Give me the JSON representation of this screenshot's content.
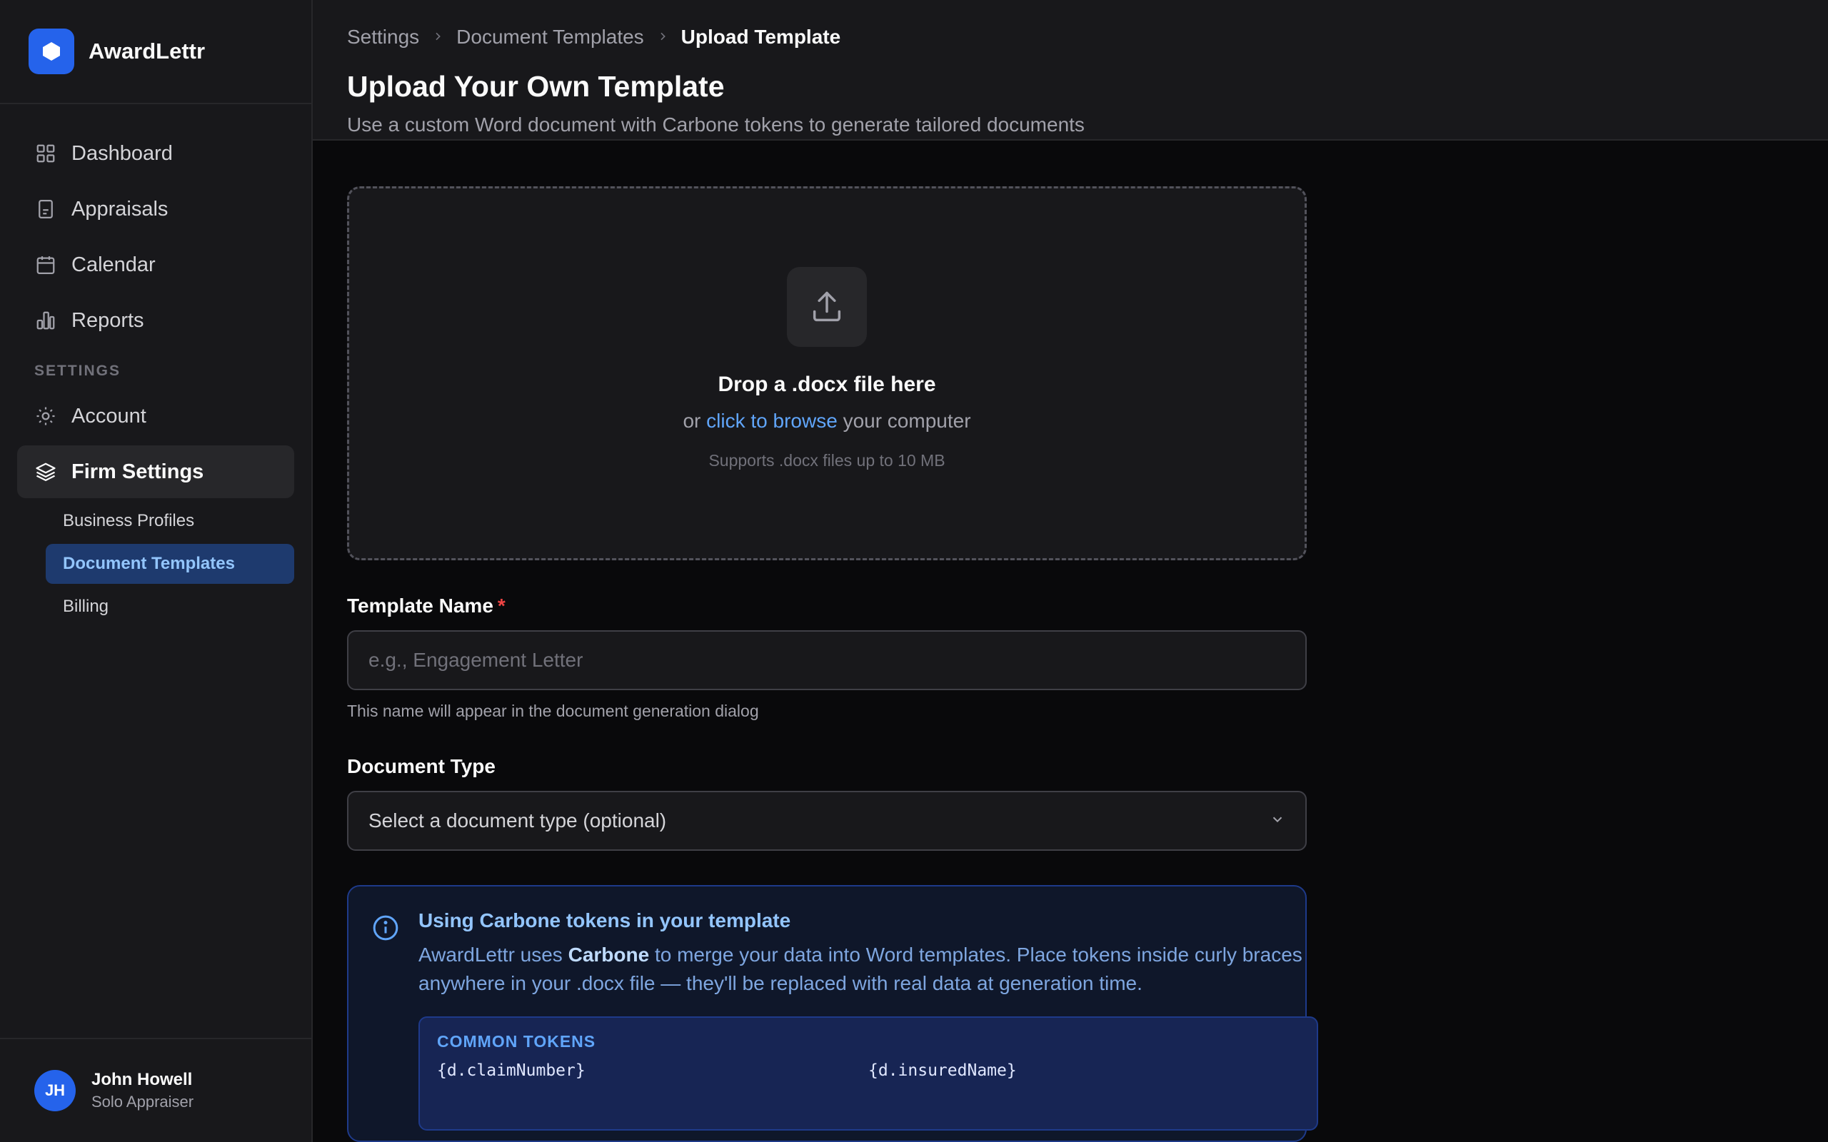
{
  "brand": {
    "name": "AwardLettr"
  },
  "sidebar": {
    "items": [
      {
        "label": "Dashboard",
        "icon": "grid-icon"
      },
      {
        "label": "Appraisals",
        "icon": "document-icon"
      },
      {
        "label": "Calendar",
        "icon": "calendar-icon"
      },
      {
        "label": "Reports",
        "icon": "bar-chart-icon"
      }
    ],
    "section_label": "SETTINGS",
    "settings_items": [
      {
        "label": "Account",
        "icon": "gear-icon"
      },
      {
        "label": "Firm Settings",
        "icon": "layers-icon"
      }
    ],
    "sub_items": [
      {
        "label": "Business Profiles"
      },
      {
        "label": "Document Templates"
      },
      {
        "label": "Billing"
      }
    ]
  },
  "user": {
    "initials": "JH",
    "name": "John Howell",
    "role": "Solo Appraiser"
  },
  "breadcrumb": [
    "Settings",
    "Document Templates",
    "Upload Template"
  ],
  "page": {
    "title": "Upload Your Own Template",
    "subtitle": "Use a custom Word document with Carbone tokens to generate tailored documents"
  },
  "dropzone": {
    "title": "Drop a .docx file here",
    "prefix": "or",
    "link": "click to browse",
    "suffix": "your computer",
    "note": "Supports .docx files up to 10 MB"
  },
  "template_name": {
    "label": "Template Name",
    "required_mark": "*",
    "placeholder": "e.g., Engagement Letter",
    "value": "",
    "hint": "This name will appear in the document generation dialog"
  },
  "document_type": {
    "label": "Document Type",
    "selected": "Select a document type (optional)"
  },
  "info": {
    "title": "Using Carbone tokens in your template",
    "text_before": "AwardLettr uses",
    "text_bold": "Carbone",
    "text_after": "to merge your data into Word templates. Place tokens inside curly braces anywhere in your .docx file — they'll be replaced with real data at generation time.",
    "tokens_title": "COMMON TOKENS",
    "tokens": [
      "{d.claimNumber}",
      "{d.insuredName}"
    ]
  },
  "colors": {
    "accent": "#2563eb",
    "link": "#60a5fa",
    "required": "#ef4444",
    "active_sub_bg": "#1e3a6e"
  }
}
